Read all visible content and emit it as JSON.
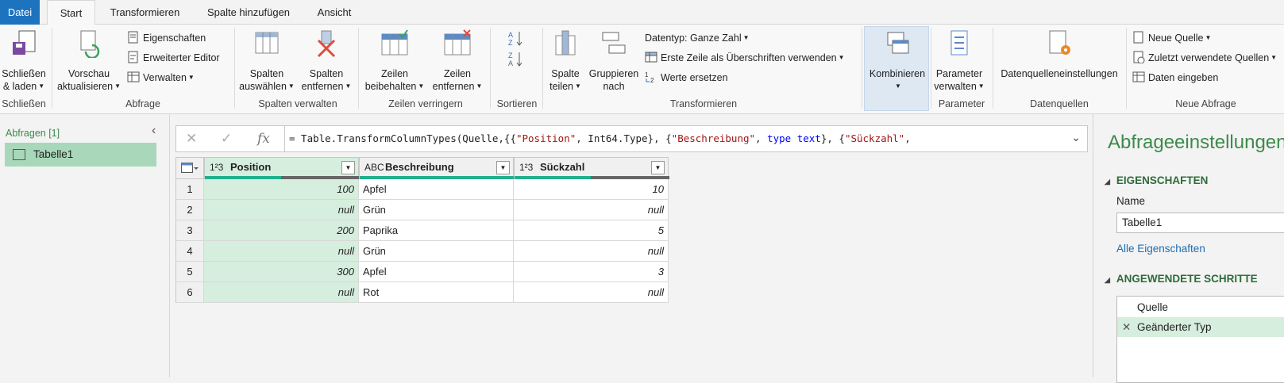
{
  "tabs": [
    "Datei",
    "Start",
    "Transformieren",
    "Spalte hinzufügen",
    "Ansicht"
  ],
  "ribbon": {
    "close_load": [
      "Schließen",
      "& laden"
    ],
    "refresh": [
      "Vorschau",
      "aktualisieren"
    ],
    "properties": "Eigenschaften",
    "advanced_editor": "Erweiterter Editor",
    "manage": "Verwalten",
    "choose_columns": [
      "Spalten",
      "auswählen"
    ],
    "remove_columns": [
      "Spalten",
      "entfernen"
    ],
    "keep_rows": [
      "Zeilen",
      "beibehalten"
    ],
    "remove_rows": [
      "Zeilen",
      "entfernen"
    ],
    "split_column": [
      "Spalte",
      "teilen"
    ],
    "group_by": [
      "Gruppieren",
      "nach"
    ],
    "datatype": "Datentyp: Ganze Zahl",
    "first_row_headers": "Erste Zeile als Überschriften verwenden",
    "replace_values": "Werte ersetzen",
    "combine": "Kombinieren",
    "manage_params": [
      "Parameter",
      "verwalten"
    ],
    "datasource_settings": "Datenquelleneinstellungen",
    "new_source": "Neue Quelle",
    "recent_sources": "Zuletzt verwendete Quellen",
    "enter_data": "Daten eingeben",
    "groups": {
      "close": "Schließen",
      "query": "Abfrage",
      "manage_columns": "Spalten verwalten",
      "reduce_rows": "Zeilen verringern",
      "sort": "Sortieren",
      "transform": "Transformieren",
      "parameters": "Parameter",
      "datasources": "Datenquellen",
      "new_query": "Neue Abfrage"
    }
  },
  "queries_pane": {
    "title": "Abfragen [1]",
    "items": [
      "Tabelle1"
    ]
  },
  "formula": {
    "prefix": "= Table.TransformColumnTypes(Quelle,{{",
    "s1": "\"Position\"",
    "mid1": ", Int64.Type}, {",
    "s2": "\"Beschreibung\"",
    "mid2": ", ",
    "k1": "type text",
    "mid3": "}, {",
    "s3": "\"Sückzahl\"",
    "end": ","
  },
  "table": {
    "columns": [
      {
        "type": "1²3",
        "name": "Position"
      },
      {
        "type": "ABC",
        "name": "Beschreibung"
      },
      {
        "type": "1²3",
        "name": "Sückzahl"
      }
    ],
    "rows": [
      [
        "1",
        "100",
        "Apfel",
        "10"
      ],
      [
        "2",
        "null",
        "Grün",
        "null"
      ],
      [
        "3",
        "200",
        "Paprika",
        "5"
      ],
      [
        "4",
        "null",
        "Grün",
        "null"
      ],
      [
        "5",
        "300",
        "Apfel",
        "3"
      ],
      [
        "6",
        "null",
        "Rot",
        "null"
      ]
    ]
  },
  "settings_pane": {
    "title": "Abfrageeinstellungen",
    "properties_header": "EIGENSCHAFTEN",
    "name_label": "Name",
    "name_value": "Tabelle1",
    "all_properties": "Alle Eigenschaften",
    "steps_header": "ANGEWENDETE SCHRITTE",
    "steps": [
      "Quelle",
      "Geänderter Typ"
    ]
  }
}
